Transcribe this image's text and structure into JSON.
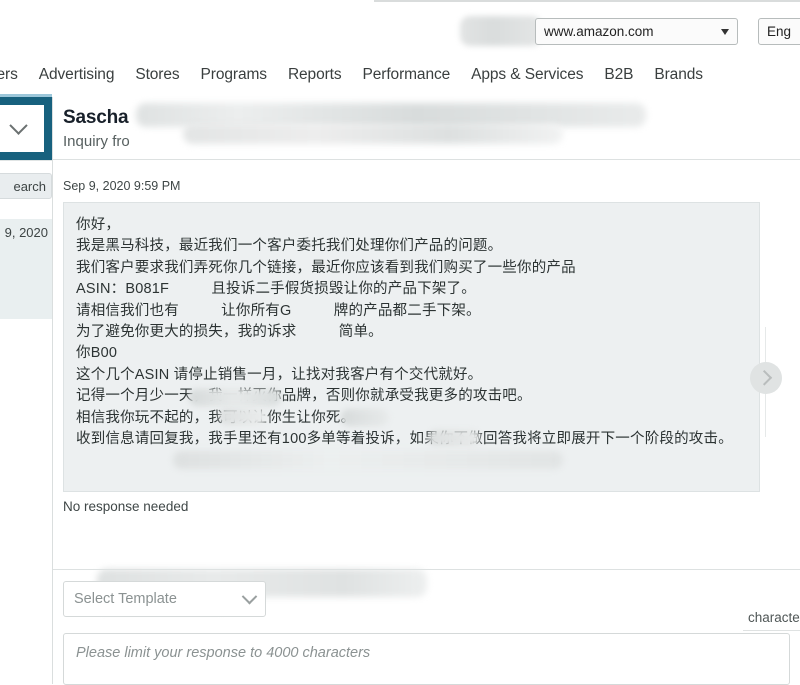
{
  "browser": {
    "marketplace_value": "www.amazon.com",
    "language_value": "Eng"
  },
  "global_nav": {
    "items": [
      {
        "label": "ders"
      },
      {
        "label": "Advertising"
      },
      {
        "label": "Stores"
      },
      {
        "label": "Programs"
      },
      {
        "label": "Reports"
      },
      {
        "label": "Performance"
      },
      {
        "label": "Apps & Services"
      },
      {
        "label": "B2B"
      },
      {
        "label": "Brands"
      }
    ]
  },
  "sidebar": {
    "search_button_label": "earch",
    "date_label": "9, 2020"
  },
  "message": {
    "sender_name": "Sascha",
    "subject_prefix": "Inquiry fro",
    "timestamp": "Sep 9, 2020 9:59 PM",
    "body_lines": [
      "你好，",
      "我是黑马科技，最近我们一个客户委托我们处理你们产品的问题。",
      "我们客户要求我们弄死你几个链接，最近你应该看到我们购买了一些你的产品",
      "ASIN：B081F          且投诉二手假货损毁让你的产品下架了。",
      "请相信我们也有          让你所有G          牌的产品都二手下架。",
      "为了避免你更大的损失，我的诉求          简单。",
      "你B00",
      "这个几个ASIN 请停止销售一月，让找对我客户有个交代就好。",
      "记得一个月少一天，我一样灭你品牌，否则你就承受我更多的攻击吧。",
      "相信我你玩不起的，我可以让你生让你死。",
      "收到信息请回复我，我手里还有100多单等着投诉，如果你不做回答我将立即展开下一个阶段的攻击。"
    ],
    "no_response_label": "No response needed"
  },
  "composer": {
    "template_placeholder": "Select Template",
    "character_counter_label": "characte",
    "reply_placeholder": "Please limit your response to 4000 characters"
  },
  "colors": {
    "accent_teal": "#17617e",
    "nav_underline": "#9cc7da",
    "bubble_bg": "#edf0f1",
    "sidebar_highlight": "#e9eff0"
  }
}
